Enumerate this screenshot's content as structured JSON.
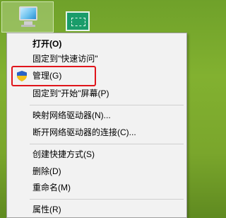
{
  "menu": {
    "open": "打开(O)",
    "pin_quick_access": "固定到\"快速访问\"",
    "manage": "管理(G)",
    "pin_start": "固定到\"开始\"屏幕(P)",
    "map_drive": "映射网络驱动器(N)...",
    "disconnect_drive": "断开网络驱动器的连接(C)...",
    "create_shortcut": "创建快捷方式(S)",
    "delete": "删除(D)",
    "rename": "重命名(M)",
    "properties": "属性(R)"
  },
  "icons": {
    "desktop": "this-pc-icon",
    "network": "network-icon",
    "manage": "uac-shield-icon"
  },
  "colors": {
    "highlight": "#e0151b",
    "menu_background": "#f2f2f2"
  }
}
